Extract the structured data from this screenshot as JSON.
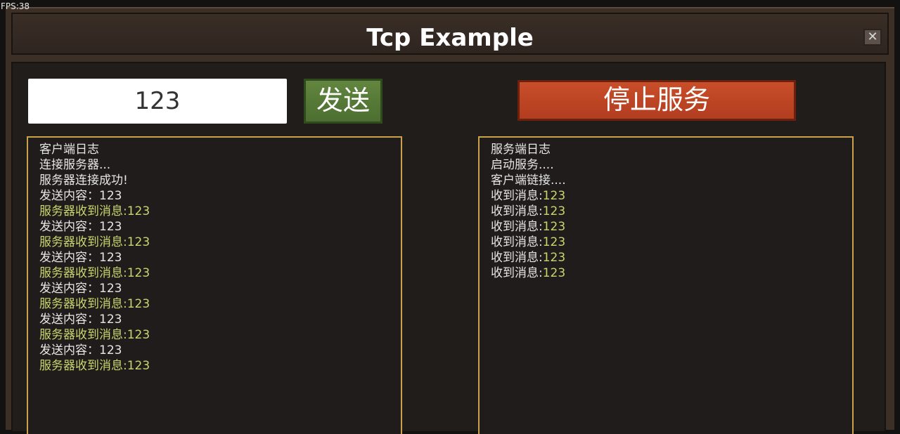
{
  "fps": "FPS:38",
  "window": {
    "title": "Tcp Example",
    "close_glyph": "✕"
  },
  "client": {
    "input_value": "123",
    "send_label": "发送",
    "log_title": "客户端日志",
    "log": [
      {
        "text": "连接服务器...",
        "kind": "normal"
      },
      {
        "text": "服务器连接成功!",
        "kind": "normal"
      },
      {
        "text": "发送内容：123",
        "kind": "normal"
      },
      {
        "text": "服务器收到消息:123",
        "kind": "recv"
      },
      {
        "text": "发送内容：123",
        "kind": "normal"
      },
      {
        "text": "服务器收到消息:123",
        "kind": "recv"
      },
      {
        "text": "发送内容：123",
        "kind": "normal"
      },
      {
        "text": "服务器收到消息:123",
        "kind": "recv"
      },
      {
        "text": "发送内容：123",
        "kind": "normal"
      },
      {
        "text": "服务器收到消息:123",
        "kind": "recv"
      },
      {
        "text": "发送内容：123",
        "kind": "normal"
      },
      {
        "text": "服务器收到消息:123",
        "kind": "recv"
      },
      {
        "text": "发送内容：123",
        "kind": "normal"
      },
      {
        "text": "服务器收到消息:123",
        "kind": "recv"
      }
    ]
  },
  "server": {
    "stop_label": "停止服务",
    "log_title": "服务端日志",
    "log": [
      {
        "label": "启动服务....",
        "value": ""
      },
      {
        "label": "客户端链接....",
        "value": ""
      },
      {
        "label": "收到消息:",
        "value": "123"
      },
      {
        "label": "收到消息:",
        "value": "123"
      },
      {
        "label": "收到消息:",
        "value": "123"
      },
      {
        "label": "收到消息:",
        "value": "123"
      },
      {
        "label": "收到消息:",
        "value": "123"
      },
      {
        "label": "收到消息:",
        "value": "123"
      }
    ]
  },
  "colors": {
    "recv_text": "#c8d66e",
    "panel_border": "#c9a24a",
    "send_button": "#587a38",
    "stop_button": "#be4725"
  }
}
